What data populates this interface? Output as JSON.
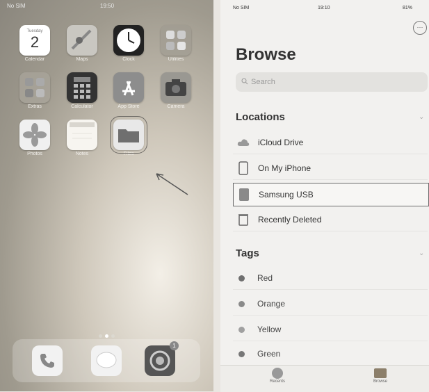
{
  "home": {
    "status": {
      "carrier": "No SIM",
      "time": "19:50"
    },
    "date_icon": {
      "weekday": "Tuesday",
      "day": "2"
    },
    "apps": [
      {
        "label": "Calendar",
        "icon": "calendar-icon"
      },
      {
        "label": "Maps",
        "icon": "maps-icon"
      },
      {
        "label": "Clock",
        "icon": "clock-icon"
      },
      {
        "label": "Utilities",
        "icon": "folder-grid-icon"
      },
      {
        "label": "Extras",
        "icon": "folder-grid-icon"
      },
      {
        "label": "Calculator",
        "icon": "calculator-icon"
      },
      {
        "label": "App Store",
        "icon": "app-store-icon"
      },
      {
        "label": "Camera",
        "icon": "camera-icon"
      },
      {
        "label": "Photos",
        "icon": "photos-icon"
      },
      {
        "label": "Notes",
        "icon": "notes-icon"
      },
      {
        "label": "Files",
        "icon": "files-icon"
      }
    ],
    "dock": [
      {
        "icon": "phone-icon"
      },
      {
        "icon": "messages-icon"
      },
      {
        "icon": "settings-icon",
        "badge": "1"
      }
    ],
    "page_dots": 3,
    "active_dot": 1
  },
  "files": {
    "status": {
      "carrier": "No SIM",
      "time": "19:10",
      "battery": "81%"
    },
    "title": "Browse",
    "search_placeholder": "Search",
    "locations_header": "Locations",
    "locations": [
      {
        "label": "iCloud Drive",
        "icon": "icloud-icon"
      },
      {
        "label": "On My iPhone",
        "icon": "iphone-icon"
      },
      {
        "label": "Samsung USB",
        "icon": "usb-drive-icon",
        "highlighted": true
      },
      {
        "label": "Recently Deleted",
        "icon": "trash-icon"
      }
    ],
    "tags_header": "Tags",
    "tags": [
      {
        "label": "Red",
        "color": "#6f6f6f"
      },
      {
        "label": "Orange",
        "color": "#8a8a8a"
      },
      {
        "label": "Yellow",
        "color": "#a0a0a0"
      },
      {
        "label": "Green",
        "color": "#777777"
      }
    ],
    "tabs": [
      {
        "label": "Recents",
        "icon": "clock-tab-icon"
      },
      {
        "label": "Browse",
        "icon": "folder-tab-icon"
      }
    ]
  }
}
